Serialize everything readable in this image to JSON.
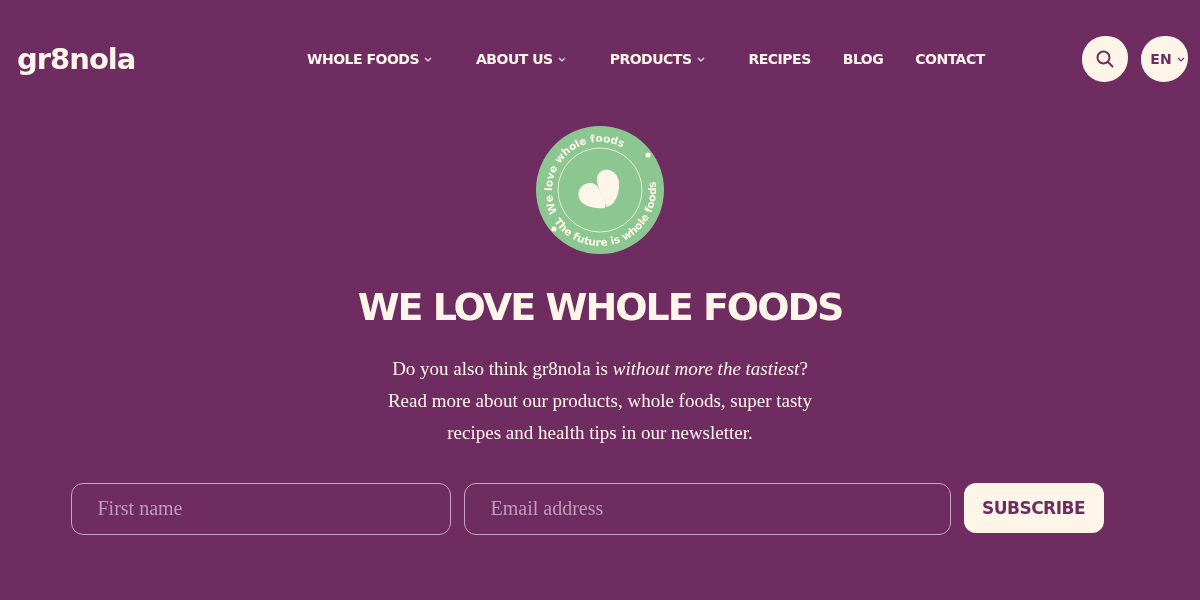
{
  "header": {
    "logo": "gr8nola",
    "nav": [
      {
        "label": "WHOLE FOODS",
        "kind": "dropdown"
      },
      {
        "label": "ABOUT US",
        "kind": "dropdown"
      },
      {
        "label": "PRODUCTS",
        "kind": "dropdown"
      },
      {
        "label": "RECIPES",
        "kind": "link"
      },
      {
        "label": "BLOG",
        "kind": "link"
      },
      {
        "label": "CONTACT",
        "kind": "link"
      }
    ],
    "language": "EN"
  },
  "badge": {
    "top_text": "We love whole foods",
    "bottom_text": "The future is whole foods"
  },
  "hero": {
    "title": "WE LOVE WHOLE FOODS",
    "lines": [
      "Do you also think gr8nola is *without more the tastiest*?",
      "Read more about our products, whole foods, super tasty",
      "recipes and health tips in our newsletter."
    ]
  },
  "form": {
    "first_name": {
      "placeholder": "First name"
    },
    "email": {
      "placeholder": "Email address"
    },
    "button": "SUBSCRIBE"
  }
}
